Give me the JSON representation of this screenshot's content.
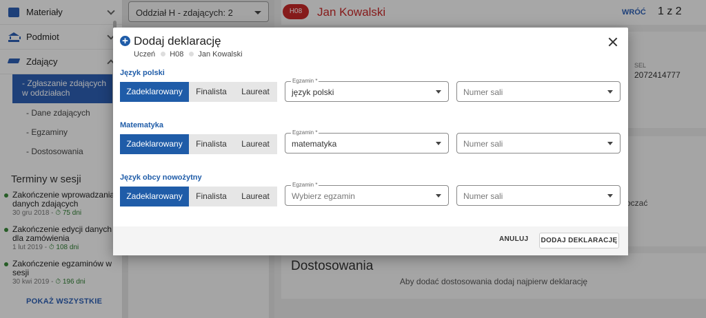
{
  "sidebar": {
    "items": [
      {
        "label": "Materiały",
        "icon": "folder-icon"
      },
      {
        "label": "Podmiot",
        "icon": "bank-icon"
      },
      {
        "label": "Zdający",
        "icon": "graduation-cap-icon"
      }
    ],
    "subitems": [
      {
        "label": "- Zgłaszanie zdających w oddziałach",
        "active": true
      },
      {
        "label": "- Dane zdających"
      },
      {
        "label": "- Egzaminy"
      },
      {
        "label": "- Dostosowania"
      }
    ],
    "terms_title": "Terminy w sesji",
    "terms": [
      {
        "title": "Zakończenie wprowadzania danych zdających",
        "date": "30 gru 2018 -",
        "days": "75 dni"
      },
      {
        "title": "Zakończenie edycji danych dla zamówienia",
        "date": "1 lut 2019 -",
        "days": "108 dni"
      },
      {
        "title": "Zakończenie egzaminów w sesji",
        "date": "30 kwi 2019 -",
        "days": "196 dni"
      }
    ],
    "show_all": "POKAŻ WSZYSTKIE"
  },
  "mid": {
    "branch_select": "Oddział H - zdających: 2"
  },
  "right": {
    "badge": "H08",
    "person": "Jan Kowalski",
    "back": "WRÓĆ",
    "pager": "1 z 2",
    "pesel_label": "SEL",
    "pesel_value": "2072414777",
    "partial_text": "oczać",
    "adjustments_title": "Dostosowania",
    "adjustments_info": "Aby dodać dostosowania dodaj najpierw deklarację"
  },
  "modal": {
    "title": "Dodaj deklarację",
    "breadcrumb": [
      "Uczeń",
      "H08",
      "Jan Kowalski"
    ],
    "subjects": [
      {
        "label": "Język polski",
        "status": [
          "Zadeklarowany",
          "Finalista",
          "Laureat"
        ],
        "selected": "Zadeklarowany",
        "exam_label": "Egzamin *",
        "exam_value": "język polski",
        "room_placeholder": "Numer sali"
      },
      {
        "label": "Matematyka",
        "status": [
          "Zadeklarowany",
          "Finalista",
          "Laureat"
        ],
        "selected": "Zadeklarowany",
        "exam_label": "Egzamin *",
        "exam_value": "matematyka",
        "room_placeholder": "Numer sali"
      },
      {
        "label": "Język obcy nowożytny",
        "status": [
          "Zadeklarowany",
          "Finalista",
          "Laureat"
        ],
        "selected": "Zadeklarowany",
        "exam_label": "Egzamin *",
        "exam_value": "Wybierz egzamin",
        "room_placeholder": "Numer sali"
      }
    ],
    "cancel": "ANULUJ",
    "submit": "DODAJ DEKLARACJĘ"
  },
  "colors": {
    "primary": "#1f5ca8",
    "badge": "#c62828",
    "accent_green": "#2e7d32"
  }
}
